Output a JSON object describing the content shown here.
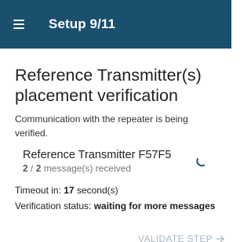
{
  "appbar": {
    "title": "Setup 9/11"
  },
  "page": {
    "title": "Reference Transmitter(s) placement verification",
    "description": "Communication with the repeater is being verified."
  },
  "transmitter": {
    "name": "Reference Transmitter F57F5",
    "received": "2",
    "total": "2",
    "count_suffix": " message(s) received",
    "separator": " / "
  },
  "status": {
    "timeout_prefix": "Timeout in: ",
    "timeout_value": "17",
    "timeout_suffix": " second(s)",
    "verification_prefix": "Verification status: ",
    "verification_value": "waiting for more messages"
  },
  "actions": {
    "validate_label": "VALIDATE STEP"
  },
  "colors": {
    "appbar": "#1b4f6e",
    "disabled_action": "#a9b9c5"
  },
  "icons": {
    "menu": "hamburger-menu-icon",
    "spinner": "loading-spinner-icon",
    "arrow": "arrow-right-icon"
  }
}
